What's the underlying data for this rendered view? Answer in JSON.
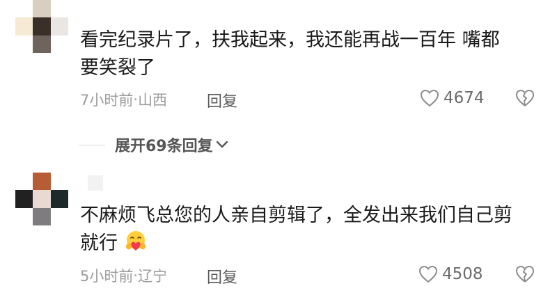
{
  "comments": [
    {
      "text_line1": "看完纪录片了，扶我起来，我还能再战一百年  嘴都",
      "text_line2": "要笑裂了",
      "time": "7小时前",
      "sep": "·",
      "location": "山西",
      "reply_label": "回复",
      "likes": "4674"
    },
    {
      "text_line1": "不麻烦飞总您的人亲自剪辑了，全发出来我们自己剪",
      "text_line2": "就行",
      "emoji": "love-hug-emoji",
      "time": "5小时前",
      "sep": "·",
      "location": "辽宁",
      "reply_label": "回复",
      "likes": "4508"
    }
  ],
  "expand_replies": {
    "label": "展开69条回复"
  },
  "colors": {
    "text": "#1a1a1a",
    "meta": "#9b9b9b",
    "icon": "#8c8c8c"
  }
}
